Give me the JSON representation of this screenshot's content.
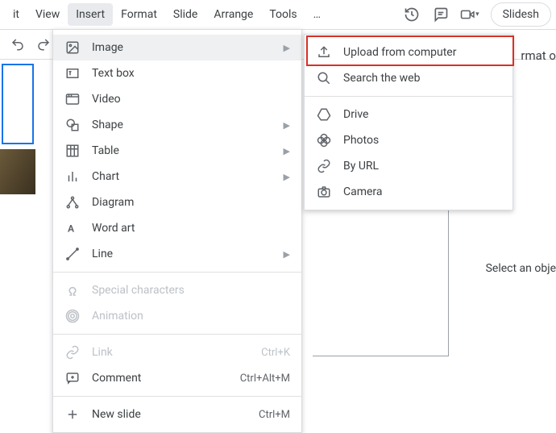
{
  "menubar": {
    "items": [
      "it",
      "View",
      "Insert",
      "Format",
      "Slide",
      "Arrange",
      "Tools"
    ],
    "overflow": "…",
    "slideshow": "Slidesh"
  },
  "right": {
    "format_hint": "rmat o",
    "select_hint": "Select an obje"
  },
  "insert_menu": {
    "image": "Image",
    "textbox": "Text box",
    "video": "Video",
    "shape": "Shape",
    "table": "Table",
    "chart": "Chart",
    "diagram": "Diagram",
    "wordart": "Word art",
    "line": "Line",
    "special": "Special characters",
    "animation": "Animation",
    "link": {
      "label": "Link",
      "shortcut": "Ctrl+K"
    },
    "comment": {
      "label": "Comment",
      "shortcut": "Ctrl+Alt+M"
    },
    "newslide": {
      "label": "New slide",
      "shortcut": "Ctrl+M"
    }
  },
  "image_submenu": {
    "upload": "Upload from computer",
    "search": "Search the web",
    "drive": "Drive",
    "photos": "Photos",
    "byurl": "By URL",
    "camera": "Camera"
  }
}
